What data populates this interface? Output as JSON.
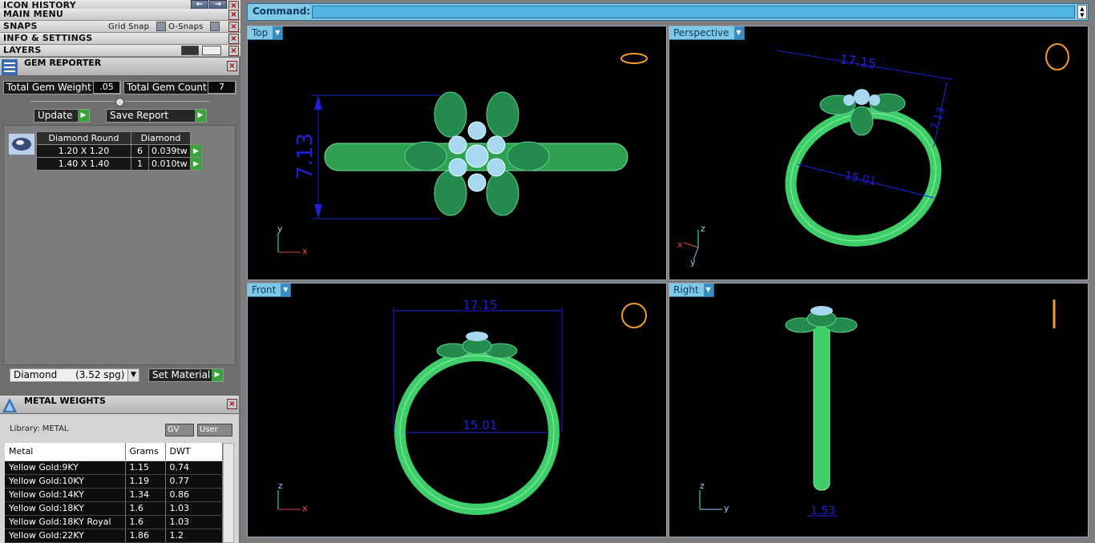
{
  "left_headers": {
    "icon_history": "ICON HISTORY",
    "main_menu": "MAIN MENU",
    "snaps": "SNAPS",
    "grid_snap": "Grid Snap",
    "o_snaps": "O-Snaps",
    "info_settings": "INFO & SETTINGS",
    "layers": "LAYERS"
  },
  "gem_reporter": {
    "title": "GEM REPORTER",
    "total_weight_label": "Total Gem Weight",
    "total_weight_value": ".05",
    "total_count_label": "Total Gem Count",
    "total_count_value": "7",
    "update_label": "Update",
    "save_report_label": "Save Report",
    "table_headers": [
      "Diamond Round",
      "Diamond"
    ],
    "rows": [
      {
        "size": "1.20 X 1.20",
        "count": "6",
        "tw": "0.039tw"
      },
      {
        "size": "1.40 X 1.40",
        "count": "1",
        "tw": "0.010tw"
      }
    ],
    "material_select": "Diamond      (3.52 spg)",
    "set_material_label": "Set Material"
  },
  "metal_weights": {
    "title": "METAL WEIGHTS",
    "library": "Library: METAL",
    "gv": "GV",
    "user": "User",
    "headers": [
      "Metal",
      "Grams",
      "DWT"
    ],
    "rows": [
      [
        "Yellow Gold:9KY",
        "1.15",
        "0.74"
      ],
      [
        "Yellow Gold:10KY",
        "1.19",
        "0.77"
      ],
      [
        "Yellow Gold:14KY",
        "1.34",
        "0.86"
      ],
      [
        "Yellow Gold:18KY",
        "1.6",
        "1.03"
      ],
      [
        "Yellow Gold:18KY Royal",
        "1.6",
        "1.03"
      ],
      [
        "Yellow Gold:22KY",
        "1.86",
        "1.2"
      ]
    ]
  },
  "command": {
    "label": "Command:",
    "value": ""
  },
  "viewports": {
    "top": "Top",
    "perspective": "Perspective",
    "front": "Front",
    "right": "Right"
  },
  "dimensions": {
    "top_height": "7.13",
    "persp_width": "17.15",
    "persp_inner": "15.01",
    "persp_depth": "7.13",
    "front_width": "17.15",
    "front_inner": "15.01",
    "right_width": "1.53"
  },
  "axes": {
    "x": "x",
    "y": "y",
    "z": "z"
  },
  "colors": {
    "cmd_bar": "#7fc8e8",
    "ring_green": "#3fcf6a",
    "dim_blue": "#2020d8",
    "gem_blue": "#a8d8f0"
  }
}
